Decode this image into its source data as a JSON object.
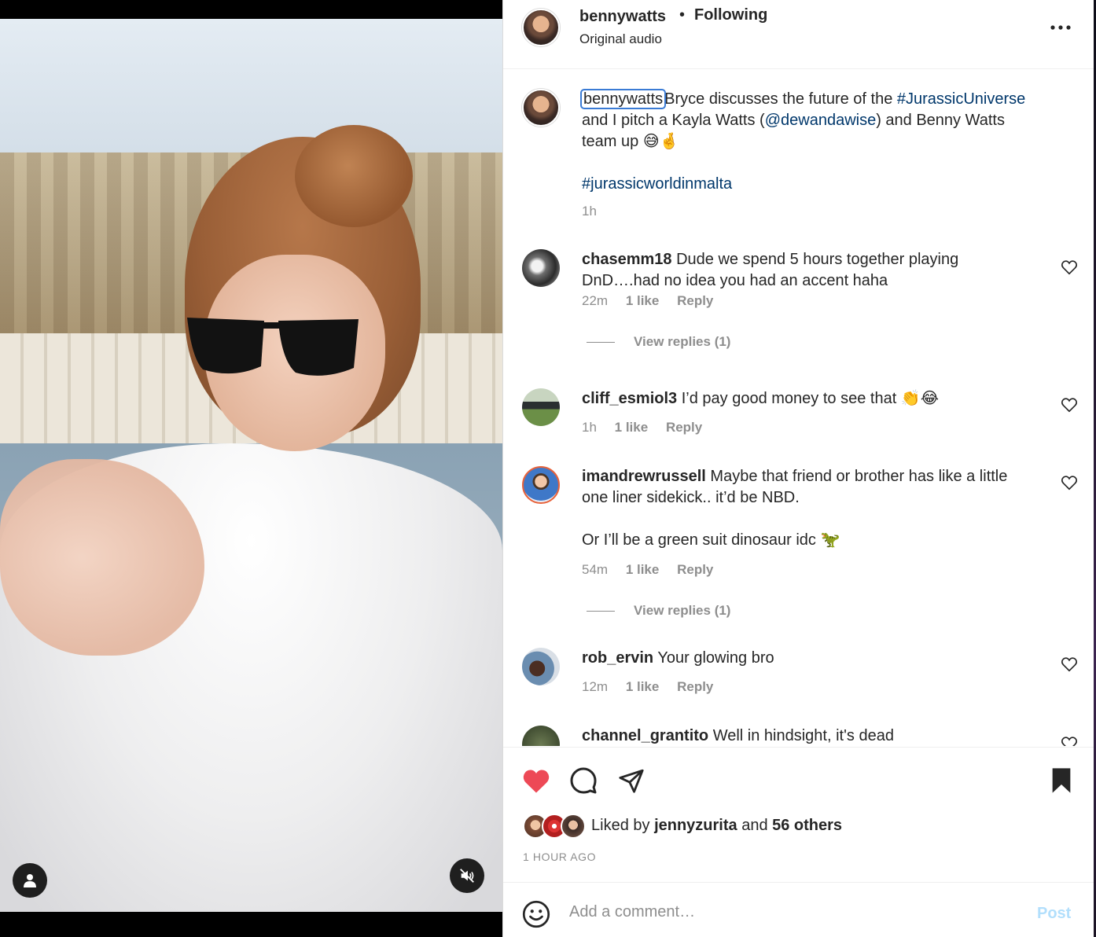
{
  "post": {
    "username": "bennywatts",
    "follow_status": "Following",
    "audio": "Original audio"
  },
  "caption": {
    "username": "bennywatts",
    "text_1": "Bryce discusses the future of the ",
    "hashtag_1": "#JurassicUniverse",
    "text_2": " and I pitch a Kayla Watts (",
    "mention": "@dewandawise",
    "text_3": ") and Benny Watts team up 😅🤞",
    "hashtag_2": "#jurassicworldinmalta",
    "time": "1h"
  },
  "comments": [
    {
      "username": "chasemm18",
      "text": "Dude we spend 5 hours together playing DnD….had no idea you had an accent haha",
      "time": "22m",
      "likes": "1 like",
      "reply": "Reply",
      "view_replies": "View replies (1)"
    },
    {
      "username": "cliff_esmiol3",
      "text": "I’d pay good money to see that 👏😂",
      "time": "1h",
      "likes": "1 like",
      "reply": "Reply"
    },
    {
      "username": "imandrewrussell",
      "text": "Maybe that friend or brother has like a little one liner sidekick.. it’d be NBD.",
      "text_2": "Or I’ll be a green suit dinosaur idc 🦖",
      "time": "54m",
      "likes": "1 like",
      "reply": "Reply",
      "view_replies": "View replies (1)"
    },
    {
      "username": "rob_ervin",
      "text": "Your glowing bro",
      "time": "12m",
      "likes": "1 like",
      "reply": "Reply"
    },
    {
      "username": "channel_grantito",
      "text": "Well in hindsight, it's dead"
    }
  ],
  "likes": {
    "prefix": "Liked by ",
    "user": "jennyzurita",
    "and": " and ",
    "others": "56 others"
  },
  "timestamp": "1 HOUR AGO",
  "composer": {
    "placeholder": "Add a comment…",
    "post_label": "Post"
  },
  "colors": {
    "link": "#00376b",
    "liked_heart": "#ed4956",
    "muted_text": "#8e8e8e",
    "post_button_disabled": "#b2dffc"
  },
  "icons": {
    "like": "heart-filled-icon",
    "comment": "comment-icon",
    "share": "paper-plane-icon",
    "save": "bookmark-filled-icon",
    "more": "more-horizontal-icon",
    "emoji": "smiley-icon",
    "mute": "speaker-muted-icon",
    "user": "user-icon"
  }
}
